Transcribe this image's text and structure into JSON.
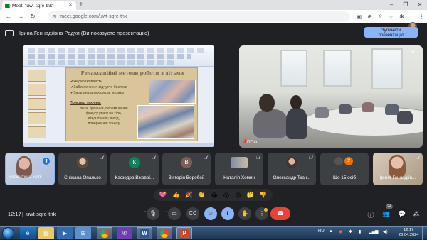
{
  "browser": {
    "tab_title": "Meet: \"uwt-sqre-tnk\"",
    "url": "meet.google.com/uwt-sqre-tnk"
  },
  "banner": {
    "presenter_text": "Ірина Геннадіївна Радул (Ви показуєте презентацію)",
    "stop_button_line1": "Зупинити",
    "stop_button_line2": "презентацію"
  },
  "slide": {
    "title": "Релаксаційні методи роботи з дітьми",
    "bullets": [
      "Недирективність",
      "Забезпечення відчуття безпеки",
      "Загальна атмосфера, музика"
    ],
    "example_heading": "Приклад техніки:",
    "example_lines": [
      "поза, дихання, переміщення",
      "фокусу уваги на тіло,",
      "візуалізація; вихід,",
      "повернення тонусу"
    ]
  },
  "camera_tile": {
    "label": "ППФ"
  },
  "participants": [
    {
      "name": "Валентина Бєлі...",
      "speaking": true
    },
    {
      "name": "Сніжана Опалько",
      "muted": true
    },
    {
      "name": "Кафедра Вікової...",
      "initial": "К",
      "color": "#12805c",
      "muted": true
    },
    {
      "name": "Вікторія Воробей",
      "initial": "В",
      "color": "#7b5e57",
      "muted": true
    },
    {
      "name": "Наталія Хомич",
      "muted": true
    },
    {
      "name": "Олександр Ткач...",
      "muted": true
    },
    {
      "name": "Ще 15 осіб",
      "initial": "У",
      "color": "#e8710a"
    },
    {
      "name": "Ірина Геннадіїв...",
      "muted": true
    }
  ],
  "reactions": [
    "💖",
    "👍",
    "🎉",
    "👏",
    "😂",
    "😮",
    "😢",
    "🤔",
    "👎"
  ],
  "controls": {
    "time": "12:17",
    "meeting_code": "uwt-sqre-tnk",
    "people_count": "24"
  },
  "taskbar": {
    "lang": "RU",
    "time": "12:17",
    "date": "26.04.2024"
  }
}
